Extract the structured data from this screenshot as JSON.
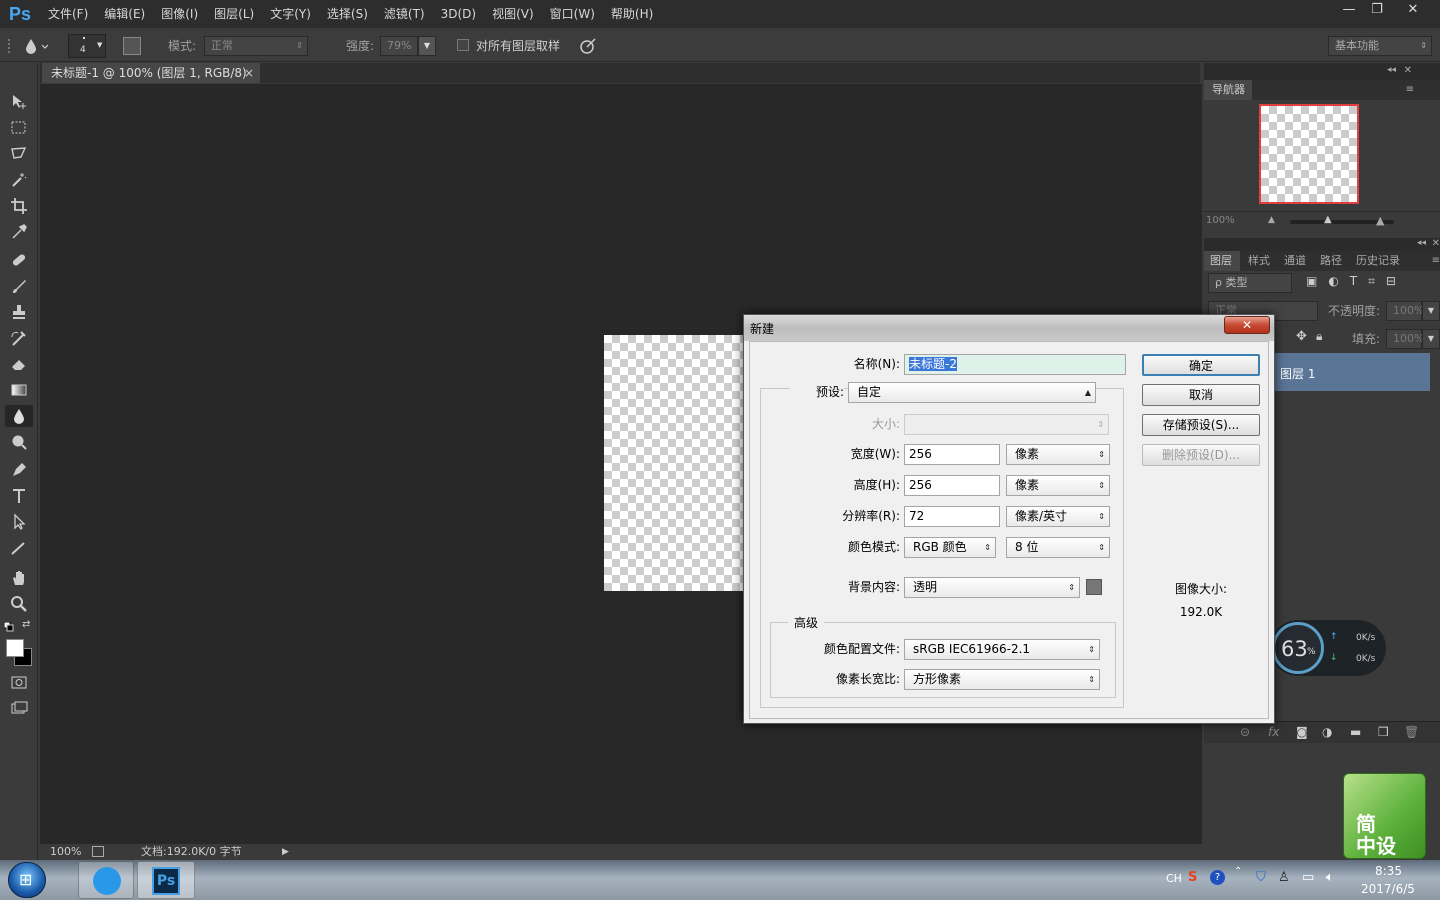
{
  "app": {
    "logo": "Ps"
  },
  "menu": [
    "文件(F)",
    "编辑(E)",
    "图像(I)",
    "图层(L)",
    "文字(Y)",
    "选择(S)",
    "滤镜(T)",
    "3D(D)",
    "视图(V)",
    "窗口(W)",
    "帮助(H)"
  ],
  "window_controls": {
    "minimize": "—",
    "restore": "❐",
    "close": "✕"
  },
  "options": {
    "brush_size": "4",
    "mode_label": "模式:",
    "mode_value": "正常",
    "strength_label": "强度:",
    "strength_value": "79%",
    "sample_all_label": "对所有图层取样",
    "workspace": "基本功能"
  },
  "doc_tab": {
    "title": "未标题-1 @ 100% (图层 1, RGB/8)",
    "close": "×"
  },
  "status": {
    "zoom": "100%",
    "doc": "文档:192.0K/0 字节"
  },
  "navigator": {
    "tab": "导航器",
    "zoom": "100%"
  },
  "layers": {
    "tabs": [
      "图层",
      "样式",
      "通道",
      "路径",
      "历史记录"
    ],
    "filter": "ρ 类型",
    "blend": "正常",
    "opacity_label": "不透明度:",
    "opacity": "100%",
    "fill_label": "填充:",
    "fill": "100%",
    "layer_name": "图层 1"
  },
  "dialog": {
    "title": "新建",
    "close": "✕",
    "name_label": "名称(N):",
    "name_value": "未标题-2",
    "preset_label": "预设:",
    "preset_value": "自定",
    "size_label": "大小:",
    "width_label": "宽度(W):",
    "width_value": "256",
    "width_unit": "像素",
    "height_label": "高度(H):",
    "height_value": "256",
    "height_unit": "像素",
    "res_label": "分辨率(R):",
    "res_value": "72",
    "res_unit": "像素/英寸",
    "color_mode_label": "颜色模式:",
    "color_mode": "RGB 颜色",
    "bit_depth": "8 位",
    "bg_label": "背景内容:",
    "bg_value": "透明",
    "advanced": "高级",
    "profile_label": "颜色配置文件:",
    "profile_value": "sRGB IEC61966-2.1",
    "aspect_label": "像素长宽比:",
    "aspect_value": "方形像素",
    "ok": "确定",
    "cancel": "取消",
    "save_preset": "存储预设(S)...",
    "delete_preset": "删除预设(D)...",
    "image_size_label": "图像大小:",
    "image_size_value": "192.0K"
  },
  "widget": {
    "percent": "63",
    "pct_sign": "%",
    "up": "0K/s",
    "down": "0K/s"
  },
  "badge": {
    "line1": "简",
    "line2": "中设"
  },
  "tray": {
    "lang": "CH",
    "time": "8:35",
    "date": "2017/6/5"
  }
}
